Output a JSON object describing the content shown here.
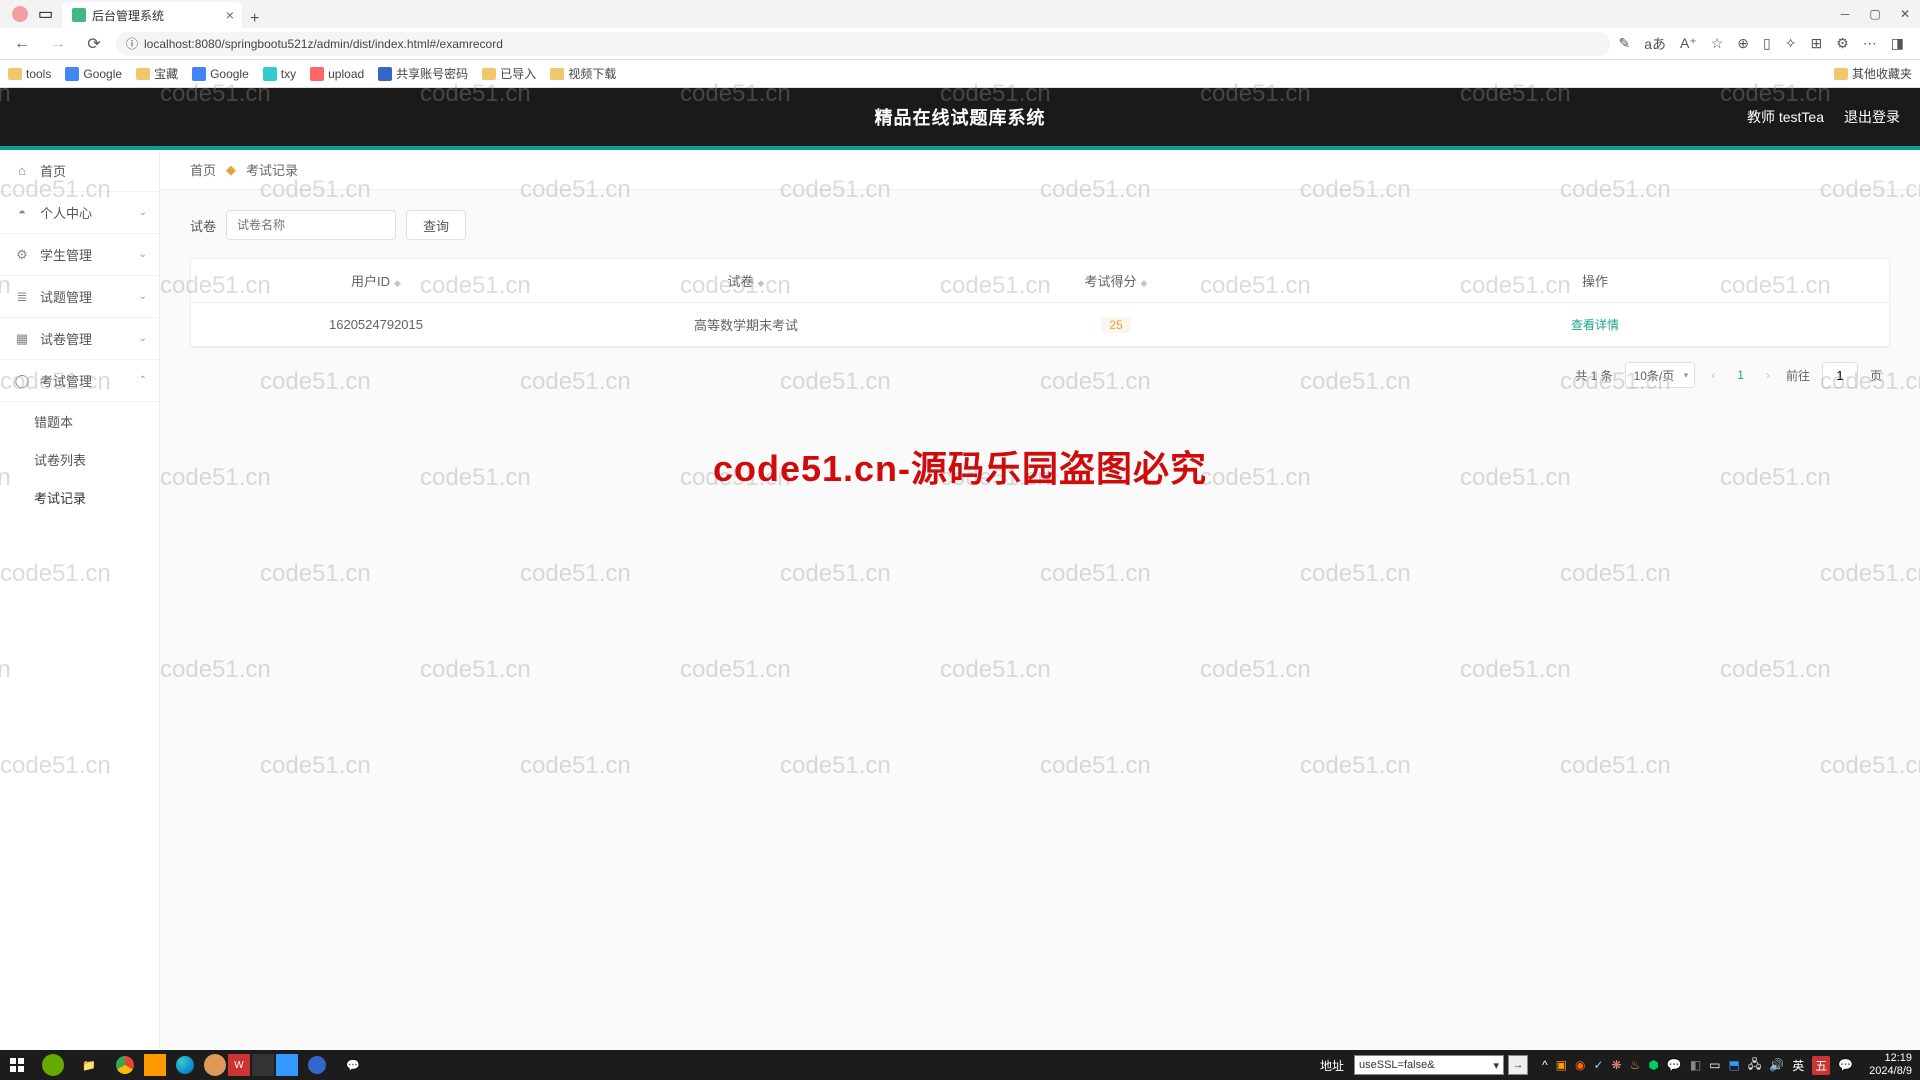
{
  "browser": {
    "tab_title": "后台管理系统",
    "url": "localhost:8080/springbootu521z/admin/dist/index.html#/examrecord",
    "bookmarks": [
      "tools",
      "Google",
      "宝藏",
      "Google",
      "txy",
      "upload",
      "共享账号密码",
      "已导入",
      "视频下载"
    ],
    "bookmark_right": "其他收藏夹"
  },
  "header": {
    "title": "精品在线试题库系统",
    "user_label": "教师 testTea",
    "logout": "退出登录"
  },
  "sidebar": {
    "items": [
      {
        "label": "首页",
        "icon": "home"
      },
      {
        "label": "个人中心",
        "icon": "user",
        "expand": true
      },
      {
        "label": "学生管理",
        "icon": "gear",
        "expand": true
      },
      {
        "label": "试题管理",
        "icon": "layers",
        "expand": true
      },
      {
        "label": "试卷管理",
        "icon": "grid",
        "expand": true
      },
      {
        "label": "考试管理",
        "icon": "circle",
        "expand": true
      }
    ],
    "subs": [
      "错题本",
      "试卷列表",
      "考试记录"
    ],
    "active_sub": "考试记录"
  },
  "breadcrumb": {
    "home": "首页",
    "current": "考试记录"
  },
  "search": {
    "label": "试卷",
    "placeholder": "试卷名称",
    "btn": "查询"
  },
  "table": {
    "headers": {
      "id": "用户ID",
      "paper": "试卷",
      "score": "考试得分",
      "op": "操作"
    },
    "rows": [
      {
        "id": "1620524792015",
        "paper": "高等数学期末考试",
        "score": "25",
        "op": "查看详情"
      }
    ]
  },
  "pagination": {
    "total": "共 1 条",
    "pagesize": "10条/页",
    "page": "1",
    "goto_label": "前往",
    "goto_val": "1",
    "goto_suffix": "页"
  },
  "watermark": {
    "text": "code51.cn",
    "center": "code51.cn-源码乐园盗图必究"
  },
  "taskbar": {
    "addr_label": "地址",
    "addr_value": "useSSL=false&",
    "time": "12:19",
    "date": "2024/8/9",
    "ime": "英",
    "ime2": "五"
  }
}
